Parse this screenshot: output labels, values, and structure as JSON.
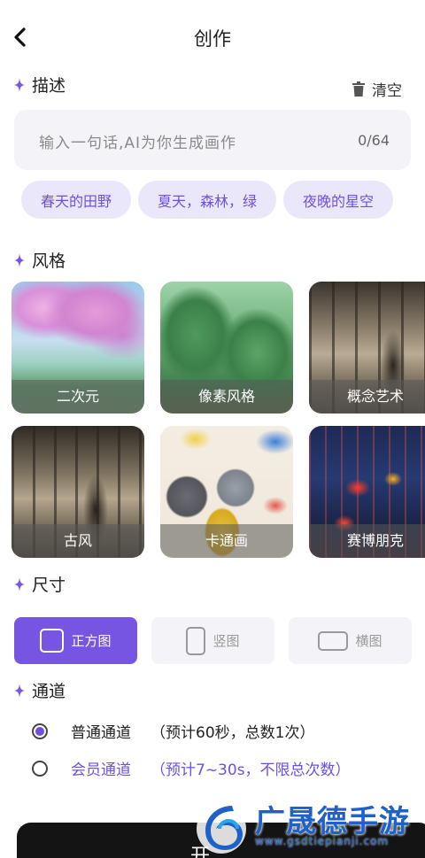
{
  "header": {
    "title": "创作"
  },
  "description": {
    "section_title": "描述",
    "clear_label": "清空",
    "placeholder": "输入一句话,AI为你生成画作",
    "counter": "0/64",
    "suggestions": [
      "春天的田野",
      "夏天，森林，绿",
      "夜晚的星空"
    ]
  },
  "style": {
    "section_title": "风格",
    "items": [
      {
        "label": "二次元",
        "selected": false
      },
      {
        "label": "像素风格",
        "selected": false
      },
      {
        "label": "概念艺术",
        "selected": false
      },
      {
        "label": "古风",
        "selected": false
      },
      {
        "label": "卡通画",
        "selected": false
      },
      {
        "label": "赛博朋克",
        "selected": false
      }
    ]
  },
  "size": {
    "section_title": "尺寸",
    "options": [
      {
        "label": "正方图",
        "selected": true
      },
      {
        "label": "竖图",
        "selected": false
      },
      {
        "label": "横图",
        "selected": false
      }
    ]
  },
  "channel": {
    "section_title": "通道",
    "options": [
      {
        "name": "普通通道",
        "note": "（预计60秒，总数1次）",
        "selected": true
      },
      {
        "name": "会员通道",
        "note": "（预计7~30s，不限总次数）",
        "selected": false
      }
    ]
  },
  "start_button": {
    "label": "开"
  },
  "watermark": {
    "title": "广晟德手游",
    "url": "www.gsdtiepianji.com"
  },
  "colors": {
    "accent": "#7755e3",
    "chip_bg": "#ebe7fb",
    "input_bg": "#f4f3f8"
  }
}
